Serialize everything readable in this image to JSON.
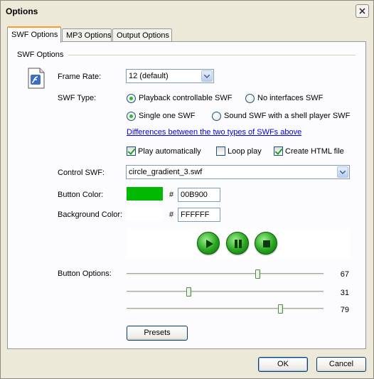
{
  "window": {
    "title": "Options"
  },
  "tabs": [
    {
      "label": "SWF Options",
      "active": true
    },
    {
      "label": "MP3 Options",
      "active": false
    },
    {
      "label": "Output Options",
      "active": false
    }
  ],
  "group": {
    "title": "SWF Options"
  },
  "frame_rate": {
    "label": "Frame Rate:",
    "value": "12 (default)"
  },
  "swf_type": {
    "label": "SWF Type:",
    "options": [
      {
        "label": "Playback controllable SWF",
        "selected": true
      },
      {
        "label": "No interfaces SWF",
        "selected": false
      }
    ],
    "options2": [
      {
        "label": "Single one SWF",
        "selected": true
      },
      {
        "label": "Sound SWF with a shell player SWF",
        "selected": false
      }
    ],
    "link": "Differences between the two types of SWFs above"
  },
  "checks": [
    {
      "label": "Play automatically",
      "checked": true
    },
    {
      "label": "Loop play",
      "checked": false
    },
    {
      "label": "Create HTML file",
      "checked": true
    }
  ],
  "control_swf": {
    "label": "Control SWF:",
    "value": "circle_gradient_3.swf"
  },
  "button_color": {
    "label": "Button Color:",
    "hash": "#",
    "value": "00B900",
    "swatch": "#00b900"
  },
  "background_color": {
    "label": "Background Color:",
    "hash": "#",
    "value": "FFFFFF",
    "swatch": "#ffffff"
  },
  "button_options": {
    "label": "Button Options:",
    "sliders": [
      {
        "value": 67
      },
      {
        "value": 31
      },
      {
        "value": 79
      }
    ]
  },
  "presets_label": "Presets",
  "ok_label": "OK",
  "cancel_label": "Cancel"
}
